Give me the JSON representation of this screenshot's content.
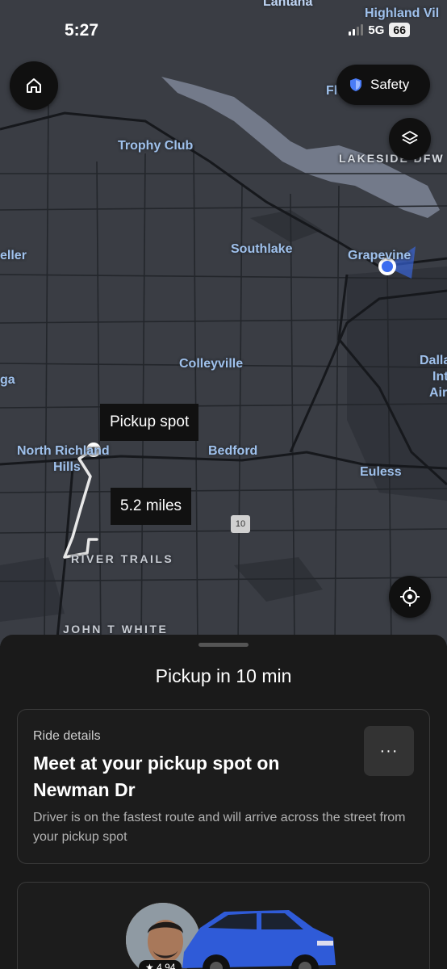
{
  "status_bar": {
    "time": "5:27",
    "network": "5G",
    "battery": "66"
  },
  "map": {
    "labels": {
      "lantana": "Lantana",
      "highland_village": "Highland Vil",
      "trophy_club": "Trophy Club",
      "lakeside": "LAKESIDE DFW",
      "keller": "eller",
      "southlake": "Southlake",
      "grapevine": "Grapevine",
      "colleyville": "Colleyville",
      "dallas": "Dalla",
      "dallas2": "Int",
      "dallas3": "Air",
      "ga": "ga",
      "north_richland": "North Richland",
      "hills": "Hills",
      "bedford": "Bedford",
      "euless": "Euless",
      "river_trails": "RIVER TRAILS",
      "john_t_white": "JOHN T WHITE",
      "fl": "Fl"
    },
    "highway": "10",
    "pickup_tag": "Pickup spot",
    "distance_tag": "5.2 miles"
  },
  "buttons": {
    "safety": "Safety",
    "more": "···"
  },
  "colors": {
    "accent_blue": "#3b6cf0",
    "map_bg": "#3a3d44",
    "water": "#737a8a"
  },
  "sheet": {
    "title": "Pickup in 10 min",
    "card": {
      "label": "Ride details",
      "heading": "Meet at your pickup spot on Newman Dr",
      "description": "Driver is on the fastest route and will arrive across the street from your pickup spot"
    },
    "driver": {
      "rating": "★ 4.94"
    }
  }
}
